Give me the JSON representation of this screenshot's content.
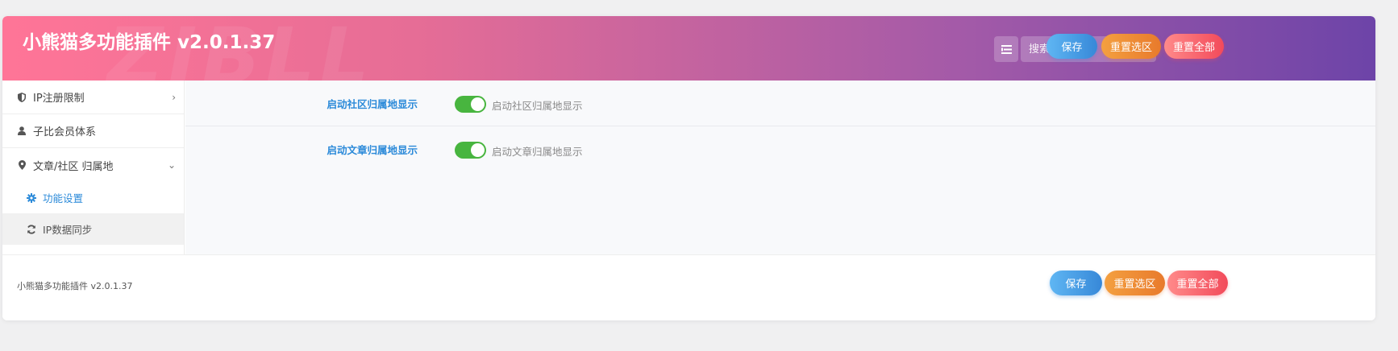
{
  "header": {
    "title": "小熊猫多功能插件 v2.0.1.37",
    "watermark": "ZIBLL",
    "search_placeholder": "搜索...",
    "save_label": "保存",
    "reset_section_label": "重置选区",
    "reset_all_label": "重置全部"
  },
  "sidebar": {
    "items": [
      {
        "label": "IP注册限制",
        "icon": "shield-icon"
      },
      {
        "label": "子比会员体系",
        "icon": "user-icon"
      },
      {
        "label": "文章/社区 归属地",
        "icon": "map-marker-icon"
      }
    ],
    "subitems": [
      {
        "label": "功能设置",
        "icon": "gear-icon"
      },
      {
        "label": "IP数据同步",
        "icon": "refresh-icon"
      }
    ]
  },
  "fields": [
    {
      "label": "启动社区归属地显示",
      "switch_text": "启动社区归属地显示",
      "enabled": true
    },
    {
      "label": "启动文章归属地显示",
      "switch_text": "启动文章归属地显示",
      "enabled": true
    }
  ],
  "footer": {
    "text": "小熊猫多功能插件 v2.0.1.37",
    "save_label": "保存",
    "reset_section_label": "重置选区",
    "reset_all_label": "重置全部"
  },
  "colors": {
    "header_gradient_start": "#ff7597",
    "header_gradient_end": "#6d44a8",
    "accent_blue": "#2b8ad9",
    "switch_on": "#48b53f"
  }
}
